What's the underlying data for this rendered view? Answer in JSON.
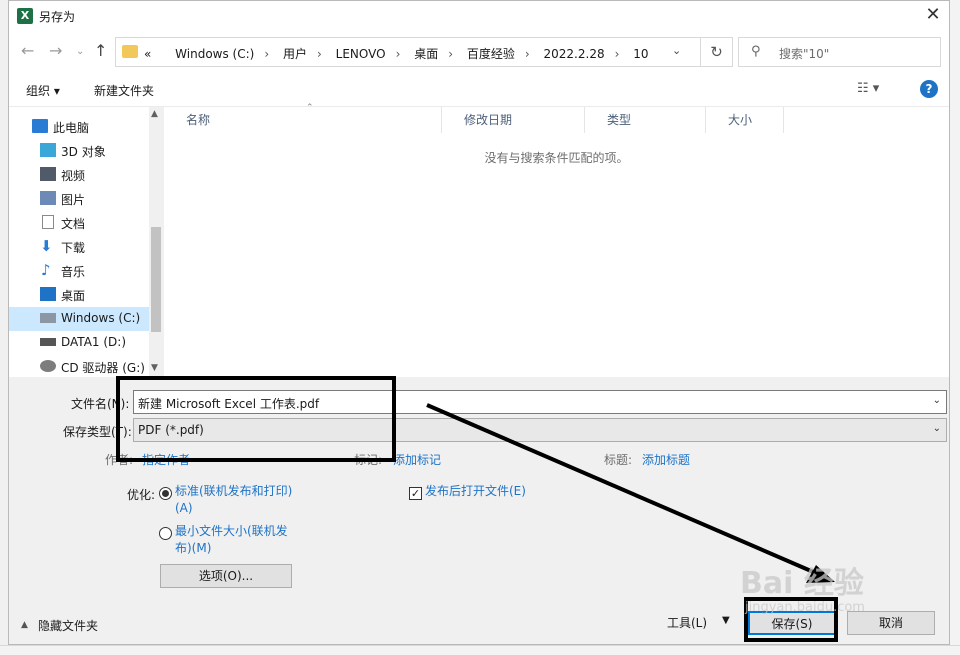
{
  "window": {
    "title": "另存为",
    "app_icon": "excel-icon"
  },
  "address": {
    "crumbs": [
      "«",
      "Windows (C:)",
      "用户",
      "LENOVO",
      "桌面",
      "百度经验",
      "2022.2.28",
      "10"
    ],
    "search_placeholder": "搜索\"10\""
  },
  "toolbar": {
    "organize": "组织 ▾",
    "new_folder": "新建文件夹"
  },
  "sidebar": {
    "items": [
      {
        "label": "此电脑",
        "icon": "pc-icon"
      },
      {
        "label": "3D 对象",
        "icon": "cube-icon"
      },
      {
        "label": "视频",
        "icon": "video-icon"
      },
      {
        "label": "图片",
        "icon": "picture-icon"
      },
      {
        "label": "文档",
        "icon": "document-icon"
      },
      {
        "label": "下载",
        "icon": "download-icon"
      },
      {
        "label": "音乐",
        "icon": "music-icon"
      },
      {
        "label": "桌面",
        "icon": "desktop-icon"
      },
      {
        "label": "Windows (C:)",
        "icon": "drive-icon"
      },
      {
        "label": "DATA1 (D:)",
        "icon": "drive-icon"
      },
      {
        "label": "CD 驱动器 (G:)",
        "icon": "cd-drive-icon"
      }
    ]
  },
  "filelist": {
    "columns": [
      "名称",
      "修改日期",
      "类型",
      "大小"
    ],
    "empty_message": "没有与搜索条件匹配的项。"
  },
  "form": {
    "filename_label": "文件名(N):",
    "filename_value": "新建 Microsoft Excel 工作表.pdf",
    "filetype_label": "保存类型(T):",
    "filetype_value": "PDF (*.pdf)",
    "author_label": "作者:",
    "author_value": "指定作者",
    "tags_label": "标记:",
    "tags_value": "添加标记",
    "title_label": "标题:",
    "title_value": "添加标题",
    "optimize_label": "优化:",
    "opt_standard_line1": "标准(联机发布和打印)",
    "opt_standard_line2": "(A)",
    "opt_min_line1": "最小文件大小(联机发",
    "opt_min_line2": "布)(M)",
    "open_after_publish": "发布后打开文件(E)",
    "options_button": "选项(O)..."
  },
  "footer": {
    "hide_folders": "隐藏文件夹",
    "tools": "工具(L)",
    "save": "保存(S)",
    "cancel": "取消"
  },
  "watermark": {
    "brand": "Bai 经验",
    "url": "jingyan.baidu.com"
  }
}
